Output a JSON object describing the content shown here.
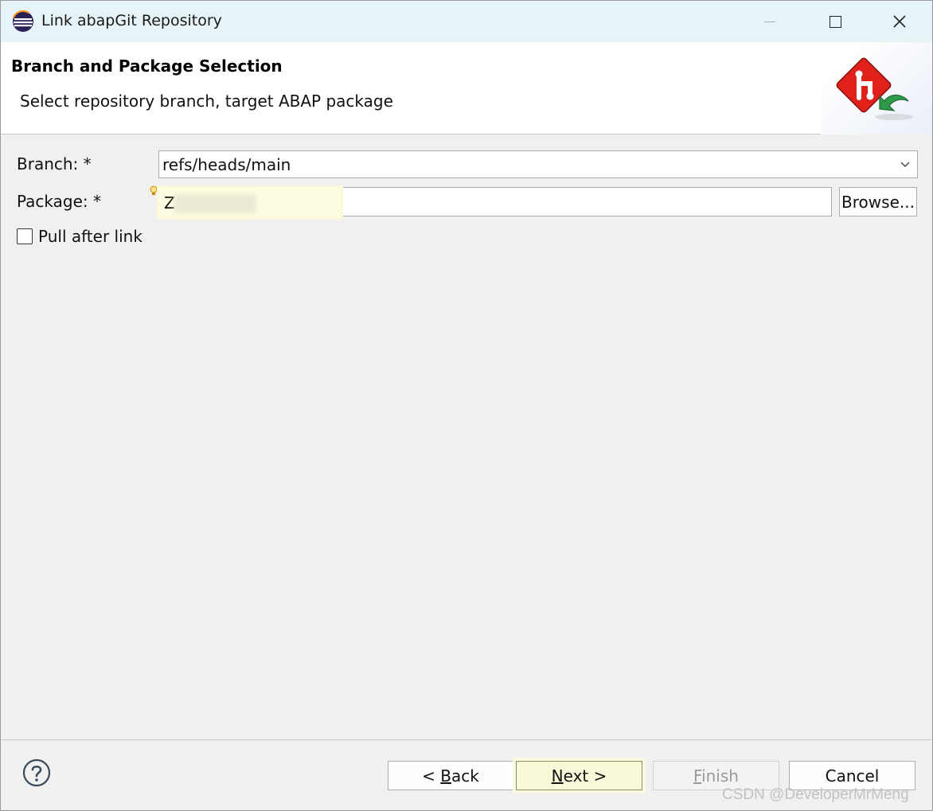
{
  "window": {
    "title": "Link abapGit Repository",
    "icon": "eclipse-icon"
  },
  "banner": {
    "title": "Branch and Package Selection",
    "description": "Select repository branch, target ABAP package",
    "logo": "abapgit-link-icon"
  },
  "form": {
    "branch_label": "Branch: *",
    "branch_value": "refs/heads/main",
    "package_label": "Package: *",
    "package_value": "Z",
    "browse_label": "Browse...",
    "pull_label": "Pull after link",
    "pull_checked": false
  },
  "footer": {
    "back_label": "< Back",
    "back_mnemonic": "B",
    "next_label": "Next >",
    "next_mnemonic": "N",
    "finish_label": "Finish",
    "finish_mnemonic": "F",
    "finish_enabled": false,
    "cancel_label": "Cancel"
  },
  "watermark": "CSDN @DeveloperMrMeng",
  "colors": {
    "titlebar": "#e6f3f7",
    "highlight": "#fdfde1",
    "logo_red": "#e0201b",
    "logo_green": "#2e9a4a"
  }
}
